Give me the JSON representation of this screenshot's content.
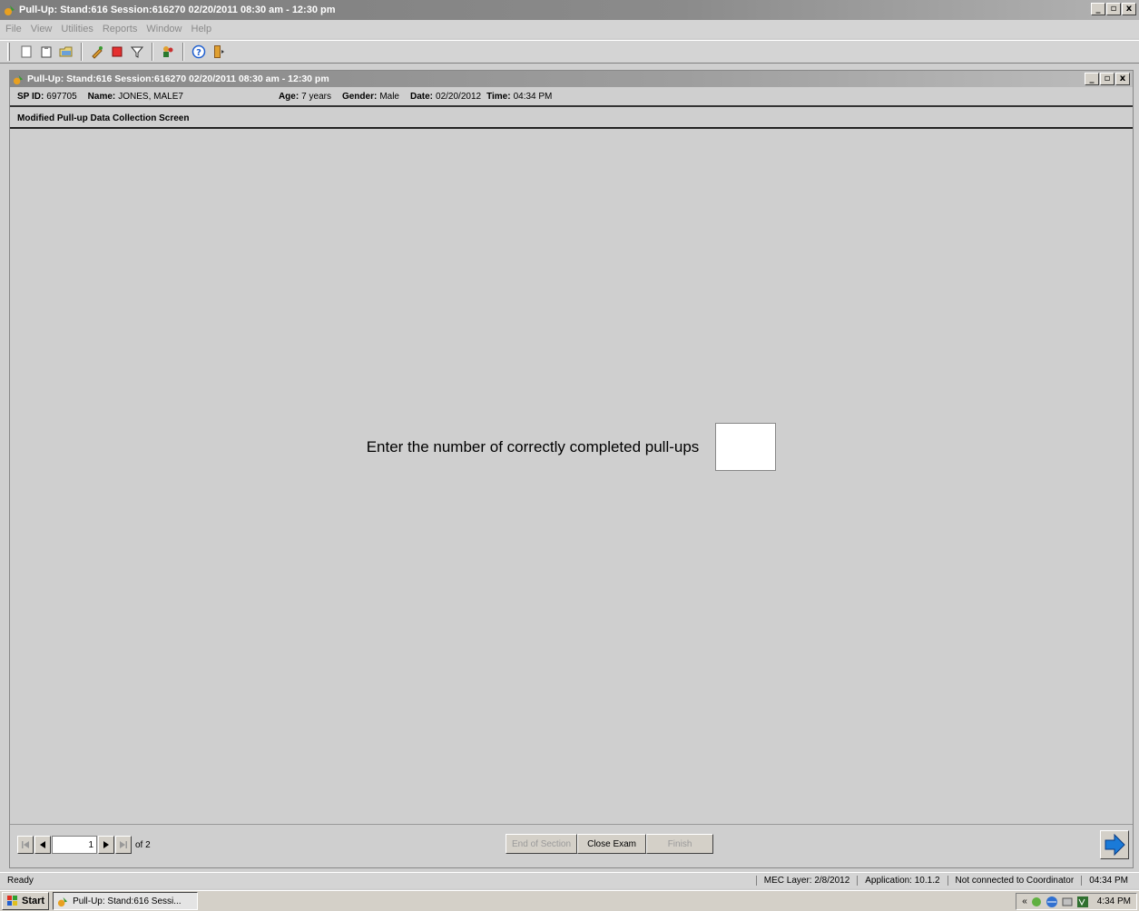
{
  "window": {
    "title": "Pull-Up: Stand:616 Session:616270 02/20/2011 08:30 am - 12:30 pm",
    "min_label": "_",
    "restore_label": "▫",
    "close_label": "x"
  },
  "menu": [
    "File",
    "View",
    "Utilities",
    "Reports",
    "Window",
    "Help"
  ],
  "toolbar": {
    "icons": [
      "new-icon",
      "clipboard-icon",
      "folder-icon",
      "edit-icon",
      "stop-icon",
      "filter-icon",
      "people-icon",
      "help-icon",
      "exit-icon"
    ],
    "colors": {
      "stop": "#e53030",
      "help": "#1f5fcf"
    }
  },
  "child_window": {
    "title": "Pull-Up: Stand:616 Session:616270 02/20/2011 08:30 am - 12:30 pm"
  },
  "participant": {
    "sp_id_label": "SP ID:",
    "sp_id": "697705",
    "name_label": "Name:",
    "name": "JONES, MALE7",
    "age_label": "Age:",
    "age": "7 years",
    "gender_label": "Gender:",
    "gender": "Male",
    "date_label": "Date:",
    "date": "02/20/2012",
    "time_label": "Time:",
    "time": "04:34 PM"
  },
  "screen": {
    "title": "Modified Pull-up Data Collection Screen",
    "prompt": "Enter the number of correctly completed pull-ups",
    "pullups_value": ""
  },
  "pager": {
    "current": "1",
    "total_label": "of 2"
  },
  "actions": {
    "end_of_section": "End of Section",
    "close_exam": "Close Exam",
    "finish": "Finish"
  },
  "status": {
    "ready": "Ready",
    "mec_layer": "MEC Layer: 2/8/2012",
    "application": "Application: 10.1.2",
    "coordinator": "Not connected to Coordinator",
    "time": "04:34 PM"
  },
  "taskbar": {
    "start": "Start",
    "task": "Pull-Up: Stand:616 Sessi...",
    "tray_chevron": "«",
    "clock": "4:34 PM"
  }
}
